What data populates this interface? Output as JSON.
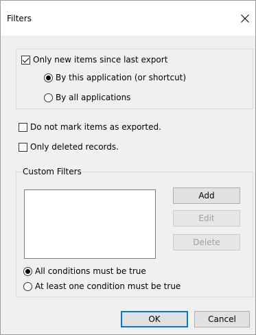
{
  "window": {
    "title": "Filters",
    "close_glyph": "✕"
  },
  "export_group": {
    "only_new_label": "Only new items since last export",
    "only_new_checked": true,
    "by_this_app_label": "By this application (or shortcut)",
    "by_all_apps_label": "By all applications",
    "selected_scope": "by_this_app"
  },
  "options": {
    "do_not_mark_label": "Do not mark items as exported.",
    "do_not_mark_checked": false,
    "only_deleted_label": "Only deleted records.",
    "only_deleted_checked": false
  },
  "custom_filters": {
    "group_label": "Custom Filters",
    "items": [],
    "add_label": "Add",
    "edit_label": "Edit",
    "delete_label": "Delete",
    "all_conditions_label": "All conditions must be true",
    "at_least_one_label": "At least one condition must be true",
    "selected_mode": "all"
  },
  "footer": {
    "ok_label": "OK",
    "cancel_label": "Cancel"
  },
  "colors": {
    "dialog_bg": "#f0f0f0",
    "titlebar_bg": "#ffffff",
    "default_button_border": "#0078d7"
  }
}
